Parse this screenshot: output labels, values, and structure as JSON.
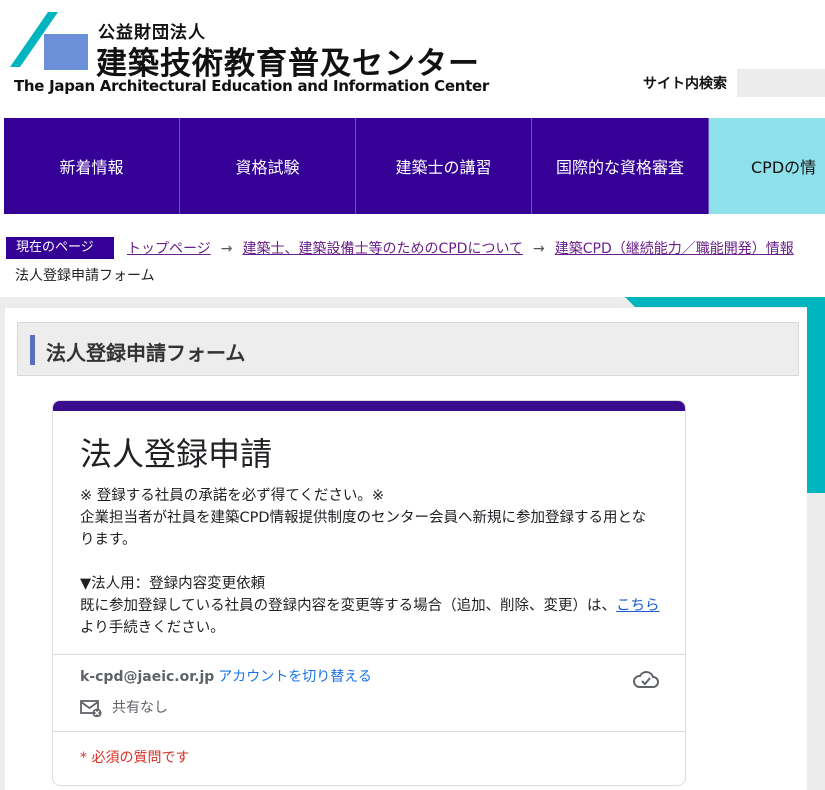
{
  "header": {
    "org_type": "公益財団法人",
    "org_name": "建築技術教育普及センター",
    "org_name_en": "The Japan Architectural Education and Information Center",
    "search_label": "サイト内検索",
    "search_value": ""
  },
  "nav": {
    "items": [
      {
        "label": "新着情報"
      },
      {
        "label": "資格試験"
      },
      {
        "label": "建築士の講習"
      },
      {
        "label": "国際的な資格審査"
      },
      {
        "label": "CPDの情"
      }
    ]
  },
  "breadcrumb": {
    "badge": "現在のページ",
    "links": [
      "トップページ",
      "建築士、建築設備士等のためのCPDについて",
      "建築CPD（継続能力／職能開発）情報"
    ],
    "arrow": "→",
    "current": "法人登録申請フォーム"
  },
  "page": {
    "heading": "法人登録申請フォーム"
  },
  "form": {
    "title": "法人登録申請",
    "desc_line1": "※ 登録する社員の承諾を必ず得てください。※",
    "desc_line2": "企業担当者が社員を建築CPD情報提供制度のセンター会員へ新規に参加登録する用となります。",
    "desc_line3": "▼法人用：登録内容変更依頼",
    "desc_line4": "既に参加登録している社員の登録内容を変更等する場合（追加、削除、変更）は、",
    "desc_link": "こちら",
    "desc_line4_tail": " より手続きください。",
    "account_email": "k-cpd@jaeic.or.jp",
    "switch_account": "アカウントを切り替える",
    "share_status": "共有なし",
    "required_note": "* 必須の質問です"
  },
  "colors": {
    "nav_bg": "#340096",
    "nav_active": "#8ee0ea",
    "accent_teal": "#00b5c0",
    "link_purple": "#6a1f8a",
    "form_accent": "#3a0d8f",
    "required_red": "#d93025"
  },
  "icons": [
    "logo-mark",
    "cloud-icon",
    "mail-off-icon"
  ]
}
